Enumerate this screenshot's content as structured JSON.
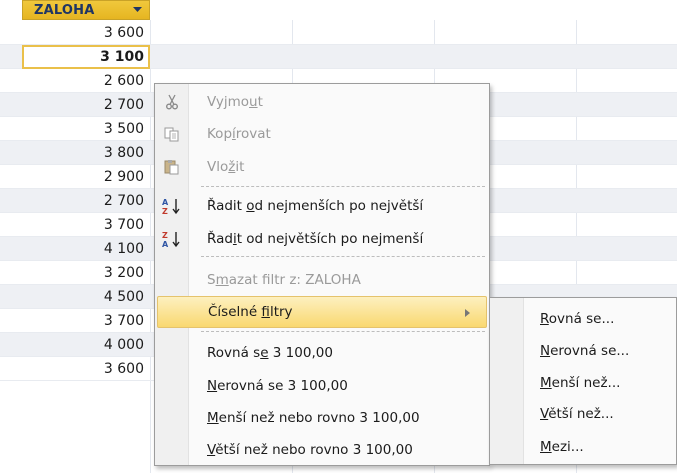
{
  "column_header": {
    "label": "ZALOHA"
  },
  "rows": [
    "3 600",
    "3 100",
    "2 600",
    "2 700",
    "3 500",
    "3 800",
    "2 900",
    "2 700",
    "3 700",
    "4 100",
    "3 200",
    "4 500",
    "3 700",
    "4 000",
    "3 600"
  ],
  "selected_row_index": 1,
  "context_menu": {
    "items": [
      {
        "pre": "Vyjmo",
        "acc": "u",
        "post": "t",
        "disabled": true,
        "icon": "scissors-icon"
      },
      {
        "pre": "Kop",
        "acc": "í",
        "post": "rovat",
        "disabled": true,
        "icon": "copy-icon"
      },
      {
        "pre": "Vlo",
        "acc": "ž",
        "post": "it",
        "disabled": true,
        "icon": "paste-icon"
      },
      {
        "pre": "Řadit ",
        "acc": "o",
        "post": "d nejmenších po největší",
        "disabled": false,
        "icon": "sort-ascending-icon"
      },
      {
        "pre": "Řad",
        "acc": "i",
        "post": "t od největších po nejmenší",
        "disabled": false,
        "icon": "sort-descending-icon"
      },
      {
        "pre": "S",
        "acc": "m",
        "post": "azat filtr z: ZALOHA",
        "disabled": true,
        "icon": ""
      },
      {
        "pre": "Číselné ",
        "acc": "f",
        "post": "iltry",
        "disabled": false,
        "icon": "",
        "highlighted": true,
        "submenu": true
      },
      {
        "pre": "Rovná s",
        "acc": "e",
        "post": " 3 100,00",
        "disabled": false,
        "icon": ""
      },
      {
        "pre": "",
        "acc": "N",
        "post": "erovná se 3 100,00",
        "disabled": false,
        "icon": ""
      },
      {
        "pre": "",
        "acc": "M",
        "post": "enší než nebo rovno 3 100,00",
        "disabled": false,
        "icon": ""
      },
      {
        "pre": "",
        "acc": "V",
        "post": "ětší než nebo rovno 3 100,00",
        "disabled": false,
        "icon": ""
      }
    ]
  },
  "submenu": {
    "items": [
      {
        "pre": "",
        "acc": "R",
        "post": "ovná se..."
      },
      {
        "pre": "",
        "acc": "N",
        "post": "erovná se..."
      },
      {
        "pre": "",
        "acc": "M",
        "post": "enší než..."
      },
      {
        "pre": "",
        "acc": "V",
        "post": "ětší než..."
      },
      {
        "pre": "",
        "acc": "M",
        "post": "ezi..."
      }
    ]
  }
}
